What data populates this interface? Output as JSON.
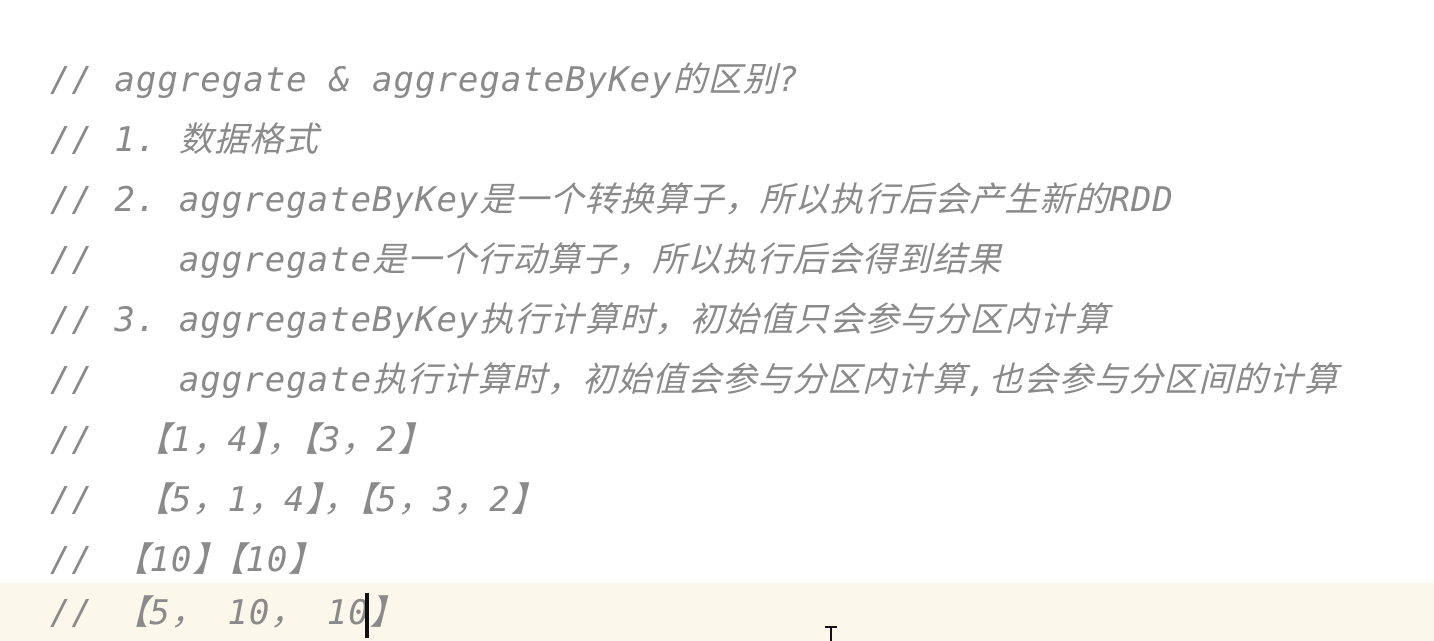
{
  "editor": {
    "lines": [
      "// aggregate & aggregateByKey的区别?",
      "// 1. 数据格式",
      "// 2. aggregateByKey是一个转换算子，所以执行后会产生新的RDD",
      "//    aggregate是一个行动算子，所以执行后会得到结果",
      "// 3. aggregateByKey执行计算时，初始值只会参与分区内计算",
      "//    aggregate执行计算时，初始值会参与分区内计算,也会参与分区间的计算",
      "//  【1，4】，【3，2】",
      "//  【5，1，4】，【5，3，2】",
      "// 【10】【10】",
      "// 【5， 10， 10】"
    ],
    "current_line": 10
  },
  "colors": {
    "comment": "#8a8a8a",
    "current_line_bg": "#fbf7ea",
    "background": "#ffffff",
    "caret": "#111111"
  }
}
